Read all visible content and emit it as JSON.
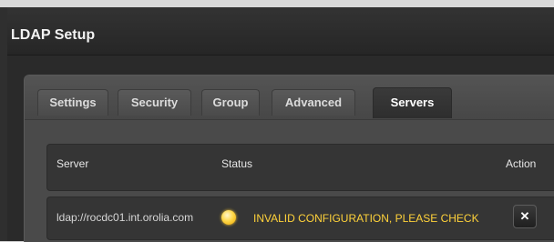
{
  "window": {
    "title": "LDAP Setup"
  },
  "tabs": [
    {
      "label": "Settings",
      "active": false
    },
    {
      "label": "Security",
      "active": false
    },
    {
      "label": "Group",
      "active": false
    },
    {
      "label": "Advanced",
      "active": false
    },
    {
      "label": "Servers",
      "active": true
    }
  ],
  "table": {
    "headers": {
      "server": "Server",
      "status": "Status",
      "action": "Action"
    },
    "rows": [
      {
        "server": "ldap://rocdc01.int.orolia.com",
        "status_icon": "warning-status-dot-icon",
        "status_text": "INVALID CONFIGURATION, PLEASE CHECK",
        "status_color": "#ffd23a",
        "action_label": "✕",
        "action_icon": "close-icon"
      }
    ]
  },
  "colors": {
    "background": "#2a2a2a",
    "panel": "#4a4a4a",
    "status_warning": "#ffd23a"
  }
}
